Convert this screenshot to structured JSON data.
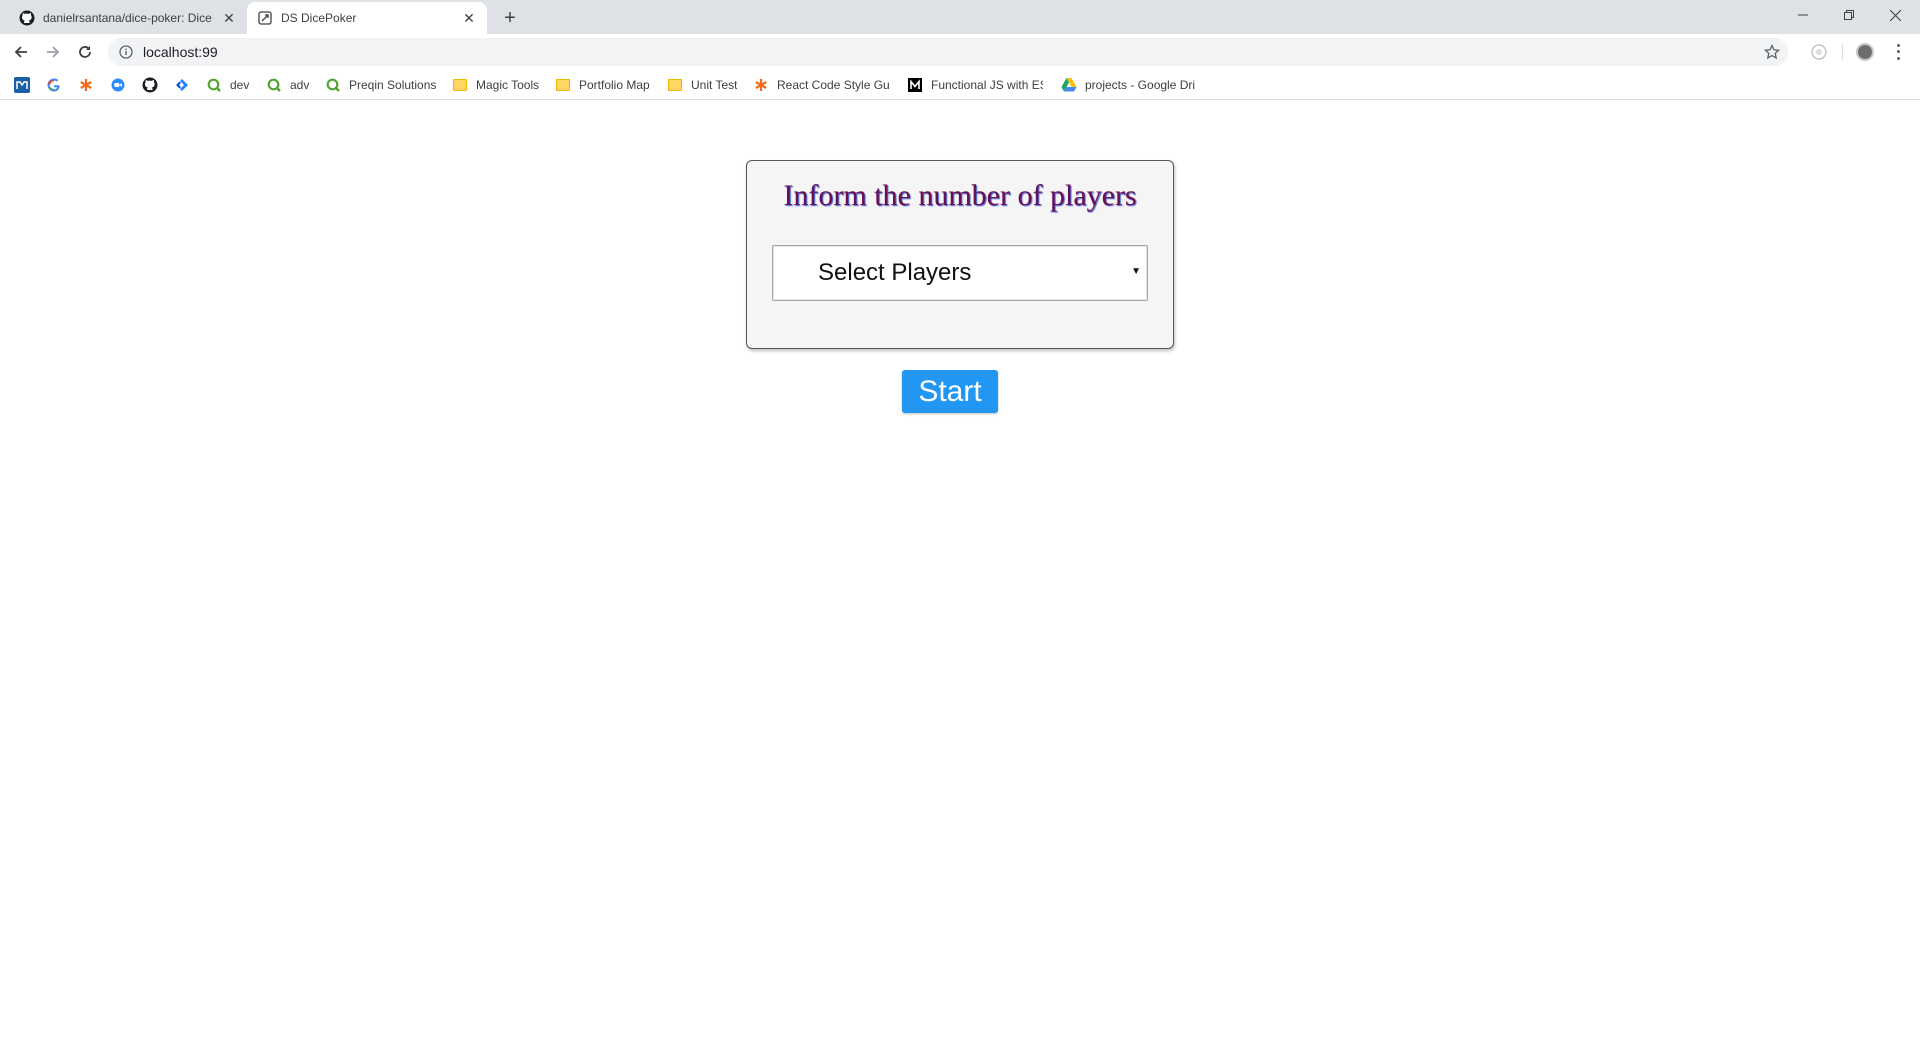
{
  "browser": {
    "tabs": [
      {
        "title": "danielrsantana/dice-poker: Dice",
        "favicon": "github-icon",
        "active": false
      },
      {
        "title": "DS DicePoker",
        "favicon": "dice-icon",
        "active": true
      }
    ],
    "address": {
      "url": "localhost:99"
    },
    "bookmarks": [
      {
        "label": "",
        "icon": "app-icon"
      },
      {
        "label": "",
        "icon": "google-icon"
      },
      {
        "label": "",
        "icon": "asterisk-icon"
      },
      {
        "label": "",
        "icon": "chat-icon"
      },
      {
        "label": "",
        "icon": "github-icon"
      },
      {
        "label": "",
        "icon": "jira-icon"
      },
      {
        "label": "dev",
        "icon": "qlik-icon"
      },
      {
        "label": "adv",
        "icon": "qlik-icon"
      },
      {
        "label": "Preqin Solutions",
        "icon": "qlik-icon"
      },
      {
        "label": "Magic Tools",
        "icon": "folder-icon"
      },
      {
        "label": "Portfolio Map",
        "icon": "folder-icon"
      },
      {
        "label": "Unit Test",
        "icon": "folder-icon"
      },
      {
        "label": "React Code Style Gui",
        "icon": "asterisk-icon"
      },
      {
        "label": "Functional JS with ES",
        "icon": "medium-icon"
      },
      {
        "label": "projects - Google Dri",
        "icon": "drive-icon"
      }
    ]
  },
  "page": {
    "title": "Inform the number of players",
    "select": {
      "selected": "Select Players"
    },
    "start_label": "Start"
  },
  "colors": {
    "title": "#6b0f4f",
    "start_button": "#2196f3"
  }
}
